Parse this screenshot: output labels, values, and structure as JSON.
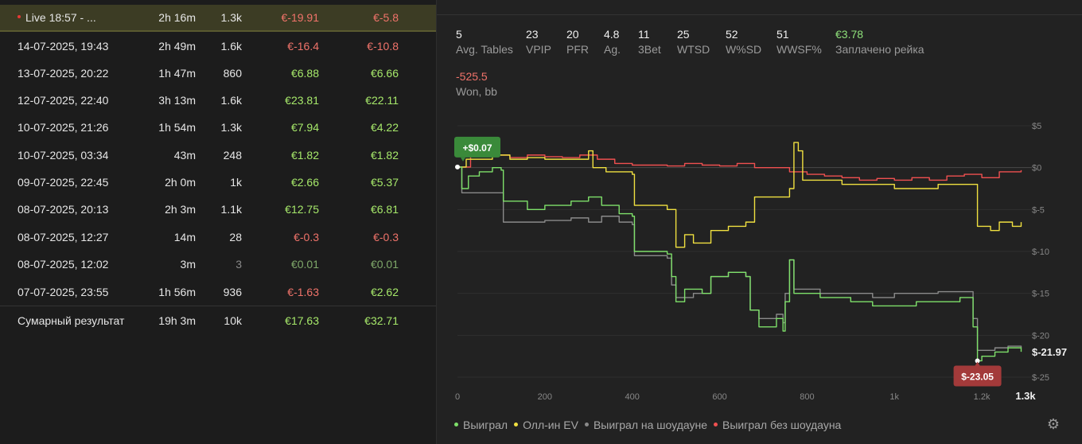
{
  "sessions": [
    {
      "date": "Live 18:57 - ...",
      "duration": "2h 16m",
      "hands": "1.3k",
      "won": "€-19.91",
      "ev": "€-5.8",
      "won_class": "neg",
      "ev_class": "neg",
      "live": true
    },
    {
      "date": "14-07-2025, 19:43",
      "duration": "2h 49m",
      "hands": "1.6k",
      "won": "€-16.4",
      "ev": "€-10.8",
      "won_class": "neg",
      "ev_class": "neg"
    },
    {
      "date": "13-07-2025, 20:22",
      "duration": "1h 47m",
      "hands": "860",
      "won": "€6.88",
      "ev": "€6.66",
      "won_class": "pos",
      "ev_class": "pos"
    },
    {
      "date": "12-07-2025, 22:40",
      "duration": "3h 13m",
      "hands": "1.6k",
      "won": "€23.81",
      "ev": "€22.11",
      "won_class": "pos",
      "ev_class": "pos"
    },
    {
      "date": "10-07-2025, 21:26",
      "duration": "1h 54m",
      "hands": "1.3k",
      "won": "€7.94",
      "ev": "€4.22",
      "won_class": "pos",
      "ev_class": "pos"
    },
    {
      "date": "10-07-2025, 03:34",
      "duration": "43m",
      "hands": "248",
      "won": "€1.82",
      "ev": "€1.82",
      "won_class": "pos",
      "ev_class": "pos"
    },
    {
      "date": "09-07-2025, 22:45",
      "duration": "2h 0m",
      "hands": "1k",
      "won": "€2.66",
      "ev": "€5.37",
      "won_class": "pos",
      "ev_class": "pos"
    },
    {
      "date": "08-07-2025, 20:13",
      "duration": "2h 3m",
      "hands": "1.1k",
      "won": "€12.75",
      "ev": "€6.81",
      "won_class": "pos",
      "ev_class": "pos"
    },
    {
      "date": "08-07-2025, 12:27",
      "duration": "14m",
      "hands": "28",
      "won": "€-0.3",
      "ev": "€-0.3",
      "won_class": "neg",
      "ev_class": "neg"
    },
    {
      "date": "08-07-2025, 12:02",
      "duration": "3m",
      "hands": "3",
      "won": "€0.01",
      "ev": "€0.01",
      "won_class": "dimgreen",
      "ev_class": "dimgreen",
      "hands_class": "dim"
    },
    {
      "date": "07-07-2025, 23:55",
      "duration": "1h 56m",
      "hands": "936",
      "won": "€-1.63",
      "ev": "€2.62",
      "won_class": "neg",
      "ev_class": "pos"
    }
  ],
  "total": {
    "date": "Сумарный результат",
    "duration": "19h 3m",
    "hands": "10k",
    "won": "€17.63",
    "ev": "€32.71"
  },
  "stats": [
    {
      "value": "5",
      "label": "Avg. Tables"
    },
    {
      "value": "23",
      "label": "VPIP"
    },
    {
      "value": "20",
      "label": "PFR"
    },
    {
      "value": "4.8",
      "label": "Ag."
    },
    {
      "value": "11",
      "label": "3Bet"
    },
    {
      "value": "25",
      "label": "WTSD"
    },
    {
      "value": "52",
      "label": "W%SD"
    },
    {
      "value": "51",
      "label": "WWSF%"
    },
    {
      "value": "€3.78",
      "label": "Заплачено рейка",
      "cls": "green"
    }
  ],
  "won_bb": {
    "value": "-525.5",
    "label": "Won, bb"
  },
  "colors": {
    "won": "#7ee06a",
    "allin_ev": "#f0e040",
    "showdown": "#8a8a8a",
    "non_showdown": "#f05050"
  },
  "chart_data": {
    "type": "line",
    "x_ticks": [
      "0",
      "200",
      "400",
      "600",
      "800",
      "1k",
      "1.2k",
      "1.3k"
    ],
    "y_ticks": [
      "$5",
      "$0",
      "$-5",
      "$-10",
      "$-15",
      "$-20",
      "$-25"
    ],
    "xlim": [
      0,
      1300
    ],
    "ylim": [
      -25,
      5
    ],
    "start_label": "+$0.07",
    "min_label": "$-23.05",
    "end_label": "$-21.97",
    "series": [
      {
        "name": "Выиграл",
        "color": "#7ee06a",
        "points": [
          [
            0,
            0.07
          ],
          [
            10,
            -2.5
          ],
          [
            25,
            -1
          ],
          [
            50,
            -0.5
          ],
          [
            80,
            0
          ],
          [
            100,
            -0.3
          ],
          [
            105,
            -4
          ],
          [
            160,
            -5
          ],
          [
            200,
            -4.5
          ],
          [
            260,
            -4
          ],
          [
            300,
            -3.5
          ],
          [
            330,
            -4.5
          ],
          [
            370,
            -5.5
          ],
          [
            400,
            -5.8
          ],
          [
            405,
            -10
          ],
          [
            480,
            -10.3
          ],
          [
            490,
            -13
          ],
          [
            500,
            -16
          ],
          [
            520,
            -14.5
          ],
          [
            560,
            -15
          ],
          [
            580,
            -13
          ],
          [
            620,
            -12.5
          ],
          [
            660,
            -13
          ],
          [
            670,
            -17
          ],
          [
            690,
            -19
          ],
          [
            730,
            -18
          ],
          [
            745,
            -19.5
          ],
          [
            750,
            -16
          ],
          [
            760,
            -11
          ],
          [
            770,
            -15
          ],
          [
            830,
            -15.5
          ],
          [
            900,
            -16
          ],
          [
            950,
            -16.5
          ],
          [
            1000,
            -16.5
          ],
          [
            1050,
            -16
          ],
          [
            1100,
            -16
          ],
          [
            1150,
            -15.5
          ],
          [
            1170,
            -15.5
          ],
          [
            1180,
            -19
          ],
          [
            1190,
            -23.05
          ],
          [
            1200,
            -22.5
          ],
          [
            1230,
            -22
          ],
          [
            1260,
            -21.5
          ],
          [
            1290,
            -21.97
          ]
        ]
      },
      {
        "name": "Олл-ин EV",
        "color": "#f0e040",
        "points": [
          [
            0,
            0.07
          ],
          [
            20,
            1
          ],
          [
            80,
            1.5
          ],
          [
            120,
            1
          ],
          [
            160,
            1.2
          ],
          [
            200,
            1
          ],
          [
            260,
            1
          ],
          [
            300,
            2
          ],
          [
            310,
            0
          ],
          [
            340,
            -0.5
          ],
          [
            380,
            -0.5
          ],
          [
            400,
            -0.8
          ],
          [
            405,
            -4.5
          ],
          [
            480,
            -5
          ],
          [
            500,
            -9.5
          ],
          [
            520,
            -8
          ],
          [
            540,
            -9
          ],
          [
            580,
            -7.5
          ],
          [
            620,
            -7
          ],
          [
            660,
            -6.5
          ],
          [
            680,
            -3.5
          ],
          [
            720,
            -3.5
          ],
          [
            760,
            -2.5
          ],
          [
            770,
            3
          ],
          [
            780,
            2
          ],
          [
            790,
            -1.5
          ],
          [
            830,
            -1.5
          ],
          [
            880,
            -2
          ],
          [
            940,
            -2
          ],
          [
            1000,
            -2.5
          ],
          [
            1060,
            -2.5
          ],
          [
            1100,
            -2
          ],
          [
            1150,
            -2
          ],
          [
            1180,
            -2
          ],
          [
            1190,
            -7
          ],
          [
            1220,
            -7.5
          ],
          [
            1240,
            -6.5
          ],
          [
            1270,
            -7
          ],
          [
            1290,
            -6.5
          ]
        ]
      },
      {
        "name": "Выиграл на шоудауне",
        "color": "#8a8a8a",
        "points": [
          [
            0,
            0.07
          ],
          [
            10,
            -3
          ],
          [
            50,
            -3
          ],
          [
            100,
            -3
          ],
          [
            105,
            -6.5
          ],
          [
            160,
            -6.5
          ],
          [
            200,
            -6.3
          ],
          [
            260,
            -6
          ],
          [
            300,
            -6.5
          ],
          [
            330,
            -5.8
          ],
          [
            370,
            -6.5
          ],
          [
            400,
            -6.8
          ],
          [
            405,
            -10.5
          ],
          [
            480,
            -10.8
          ],
          [
            490,
            -14
          ],
          [
            500,
            -15.5
          ],
          [
            540,
            -15
          ],
          [
            580,
            -13
          ],
          [
            620,
            -12.5
          ],
          [
            660,
            -13
          ],
          [
            670,
            -17
          ],
          [
            690,
            -18
          ],
          [
            730,
            -17.5
          ],
          [
            745,
            -18.5
          ],
          [
            750,
            -15
          ],
          [
            760,
            -11
          ],
          [
            770,
            -14.5
          ],
          [
            830,
            -15
          ],
          [
            900,
            -15
          ],
          [
            950,
            -15.5
          ],
          [
            1000,
            -15
          ],
          [
            1050,
            -15
          ],
          [
            1100,
            -14.8
          ],
          [
            1150,
            -14.8
          ],
          [
            1170,
            -14.8
          ],
          [
            1180,
            -18
          ],
          [
            1190,
            -21.8
          ],
          [
            1230,
            -21.5
          ],
          [
            1260,
            -21.3
          ],
          [
            1290,
            -21.5
          ]
        ]
      },
      {
        "name": "Выиграл без шоудауна",
        "color": "#f05050",
        "points": [
          [
            0,
            0.07
          ],
          [
            30,
            1.5
          ],
          [
            80,
            1.5
          ],
          [
            120,
            1.2
          ],
          [
            160,
            1.5
          ],
          [
            200,
            1.3
          ],
          [
            240,
            1.2
          ],
          [
            280,
            1.5
          ],
          [
            320,
            1
          ],
          [
            360,
            0.5
          ],
          [
            400,
            0.3
          ],
          [
            440,
            0.3
          ],
          [
            480,
            0.2
          ],
          [
            520,
            0.5
          ],
          [
            560,
            0.3
          ],
          [
            600,
            0.2
          ],
          [
            640,
            0.5
          ],
          [
            680,
            0
          ],
          [
            720,
            0
          ],
          [
            760,
            -0.5
          ],
          [
            800,
            -0.8
          ],
          [
            840,
            -1
          ],
          [
            880,
            -1.2
          ],
          [
            920,
            -1.5
          ],
          [
            960,
            -1.3
          ],
          [
            1000,
            -1.5
          ],
          [
            1040,
            -1.2
          ],
          [
            1080,
            -1.5
          ],
          [
            1120,
            -1
          ],
          [
            1160,
            -0.8
          ],
          [
            1200,
            -1.2
          ],
          [
            1240,
            -0.5
          ],
          [
            1290,
            -0.3
          ]
        ]
      }
    ]
  },
  "legend": [
    {
      "label": "Выиграл",
      "color": "#7ee06a"
    },
    {
      "label": "Олл-ин EV",
      "color": "#f0e040"
    },
    {
      "label": "Выиграл на шоудауне",
      "color": "#8a8a8a"
    },
    {
      "label": "Выиграл без шоудауна",
      "color": "#f05050"
    }
  ],
  "settings_icon": "gear-icon"
}
